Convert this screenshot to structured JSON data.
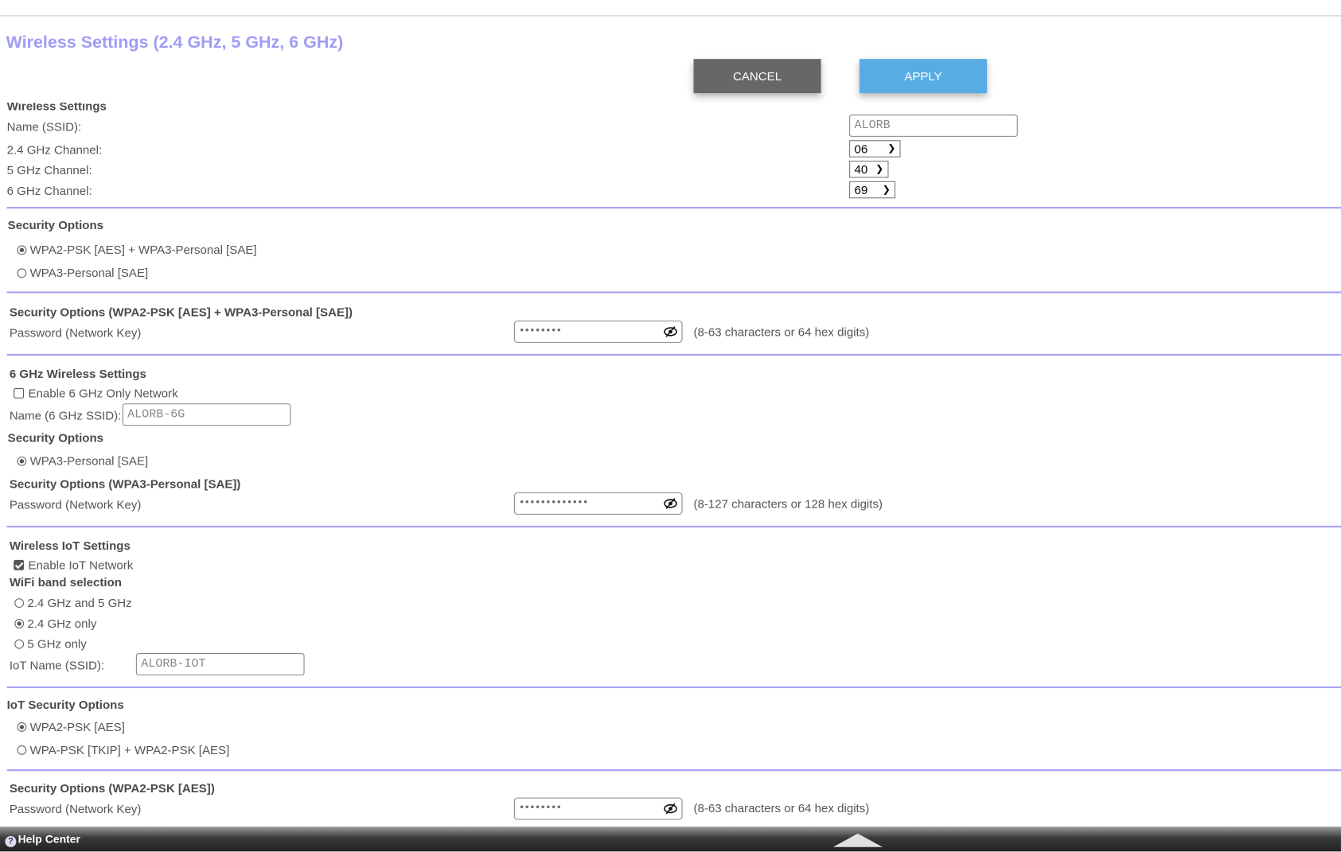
{
  "page": {
    "title": "Wireless Settings (2.4 GHz, 5 GHz, 6 GHz)",
    "cancel_label": "CANCEL",
    "apply_label": "APPLY"
  },
  "wireless": {
    "heading": "Wireless Settings",
    "ssid_label": "Name (SSID):",
    "ssid_value": "ALORB",
    "ch24_label": "2.4 GHz Channel:",
    "ch24_value": "06",
    "ch5_label": "5 GHz Channel:",
    "ch5_value": "40",
    "ch6_label": "6 GHz Channel:",
    "ch6_value": "69"
  },
  "security": {
    "heading": "Security Options",
    "options": [
      "WPA2-PSK [AES] + WPA3-Personal [SAE]",
      "WPA3-Personal [SAE]"
    ],
    "selected": 0
  },
  "security_key": {
    "heading": "Security Options (WPA2-PSK [AES] + WPA3-Personal [SAE])",
    "password_label": "Password (Network Key)",
    "password_mask": "••••••••",
    "hint": "(8-63 characters or 64 hex digits)"
  },
  "six_ghz": {
    "heading": "6 GHz Wireless Settings",
    "enable_label": "Enable 6 GHz Only Network",
    "enable_checked": false,
    "ssid_label": "Name (6 GHz SSID):",
    "ssid_value": "ALORB-6G",
    "security_heading": "Security Options",
    "security_option": "WPA3-Personal [SAE]",
    "key_heading": "Security Options (WPA3-Personal [SAE])",
    "password_label": "Password (Network Key)",
    "password_mask": "•••••••••••••",
    "hint": "(8-127 characters or 128 hex digits)"
  },
  "iot": {
    "heading": "Wireless IoT Settings",
    "enable_label": "Enable IoT Network",
    "enable_checked": true,
    "band_heading": "WiFi band selection",
    "bands": [
      "2.4 GHz and 5 GHz",
      "2.4 GHz only",
      "5 GHz only"
    ],
    "band_selected": 1,
    "ssid_label": "IoT Name (SSID):",
    "ssid_value": "ALORB-IOT"
  },
  "iot_security": {
    "heading": "IoT Security Options",
    "options": [
      "WPA2-PSK [AES]",
      "WPA-PSK [TKIP] + WPA2-PSK [AES]"
    ],
    "selected": 0
  },
  "iot_key": {
    "heading": "Security Options (WPA2-PSK [AES])",
    "password_label": "Password (Network Key)",
    "password_mask": "••••••••",
    "hint": "(8-63 characters or 64 hex digits)"
  },
  "footer": {
    "help_label": "Help Center"
  }
}
